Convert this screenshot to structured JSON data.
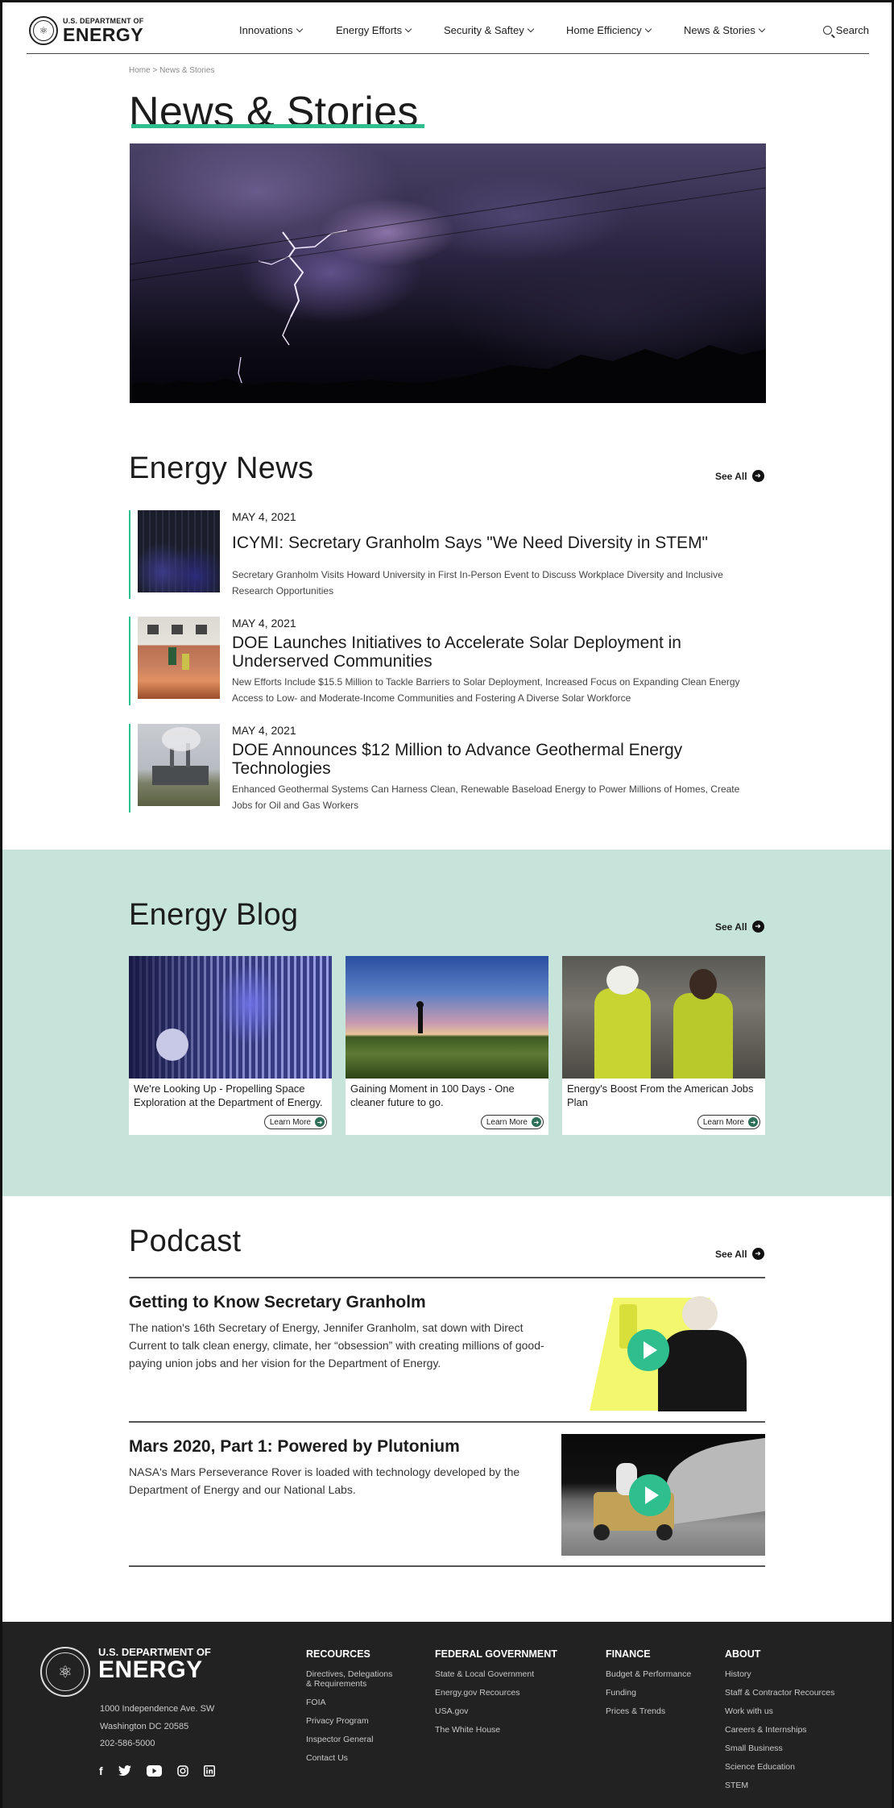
{
  "header": {
    "logo_small": "U.S. DEPARTMENT OF",
    "logo_big": "ENERGY",
    "nav": [
      "Innovations",
      "Energy Efforts",
      "Security & Saftey",
      "Home Efficiency",
      "News & Stories"
    ],
    "search_label": "Search"
  },
  "breadcrumb": "Home > News & Stories",
  "page_title": "News & Stories",
  "news": {
    "heading": "Energy News",
    "see_all": "See All",
    "items": [
      {
        "date": "MAY 4, 2021",
        "title": "ICYMI: Secretary Granholm Says \"We Need Diversity in STEM\"",
        "desc": "Secretary Granholm Visits Howard University in First In-Person Event to Discuss Workplace Diversity and Inclusive Research Opportunities"
      },
      {
        "date": "MAY 4, 2021",
        "title": "DOE Launches Initiatives to Accelerate Solar Deployment in Underserved Communities",
        "desc": "New Efforts Include $15.5 Million to Tackle Barriers to Solar Deployment, Increased Focus on Expanding Clean Energy Access to Low- and Moderate-Income Communities and Fostering A Diverse Solar Workforce"
      },
      {
        "date": "MAY 4, 2021",
        "title": "DOE Announces $12 Million to Advance Geothermal Energy Technologies",
        "desc": "Enhanced Geothermal Systems Can Harness Clean, Renewable Baseload Energy to Power Millions of Homes, Create Jobs for Oil and Gas Workers"
      }
    ]
  },
  "blog": {
    "heading": "Energy Blog",
    "see_all": "See All",
    "learn_more": "Learn More",
    "cards": [
      {
        "title": "We're Looking Up - Propelling Space Exploration at the Department of Energy."
      },
      {
        "title": "Gaining Moment in 100 Days - One cleaner future to go."
      },
      {
        "title": "Energy's Boost From the American Jobs Plan"
      }
    ]
  },
  "podcast": {
    "heading": "Podcast",
    "see_all": "See All",
    "episodes": [
      {
        "title": "Getting to Know Secretary Granholm",
        "desc": "The nation's 16th Secretary of Energy, Jennifer Granholm, sat down with Direct Current to talk clean energy, climate, her “obsession” with creating millions of good-paying union jobs and her vision for the Department of Energy."
      },
      {
        "title": "Mars 2020, Part 1: Powered by Plutonium",
        "desc": "NASA's Mars Perseverance Rover is loaded with technology developed by the Department of Energy and our National Labs."
      }
    ]
  },
  "footer": {
    "logo_small": "U.S. DEPARTMENT OF",
    "logo_big": "ENERGY",
    "address": [
      "1000 Independence Ave. SW",
      "Washington DC 20585",
      "202-586-5000"
    ],
    "social_icons": [
      "facebook-icon",
      "twitter-icon",
      "youtube-icon",
      "instagram-icon",
      "linkedin-icon"
    ],
    "columns": [
      {
        "title": "RECOURCES",
        "links": [
          "Directives, Delegations & Requirements",
          "FOIA",
          "Privacy Program",
          "Inspector General",
          "Contact Us"
        ]
      },
      {
        "title": "FEDERAL GOVERNMENT",
        "links": [
          "State & Local Government",
          "Energy.gov Recources",
          "USA.gov",
          "The White House"
        ]
      },
      {
        "title": "FINANCE",
        "links": [
          "Budget & Performance",
          "Funding",
          "Prices & Trends"
        ]
      },
      {
        "title": "ABOUT",
        "links": [
          "History",
          "Staff & Contractor Recources",
          "Work with us",
          "Careers & Internships",
          "Small Business",
          "Science Education",
          "STEM"
        ]
      }
    ]
  },
  "colors": {
    "accent": "#2fbf8f",
    "blog_band": "#c6e4da",
    "footer_bg": "#222222"
  }
}
